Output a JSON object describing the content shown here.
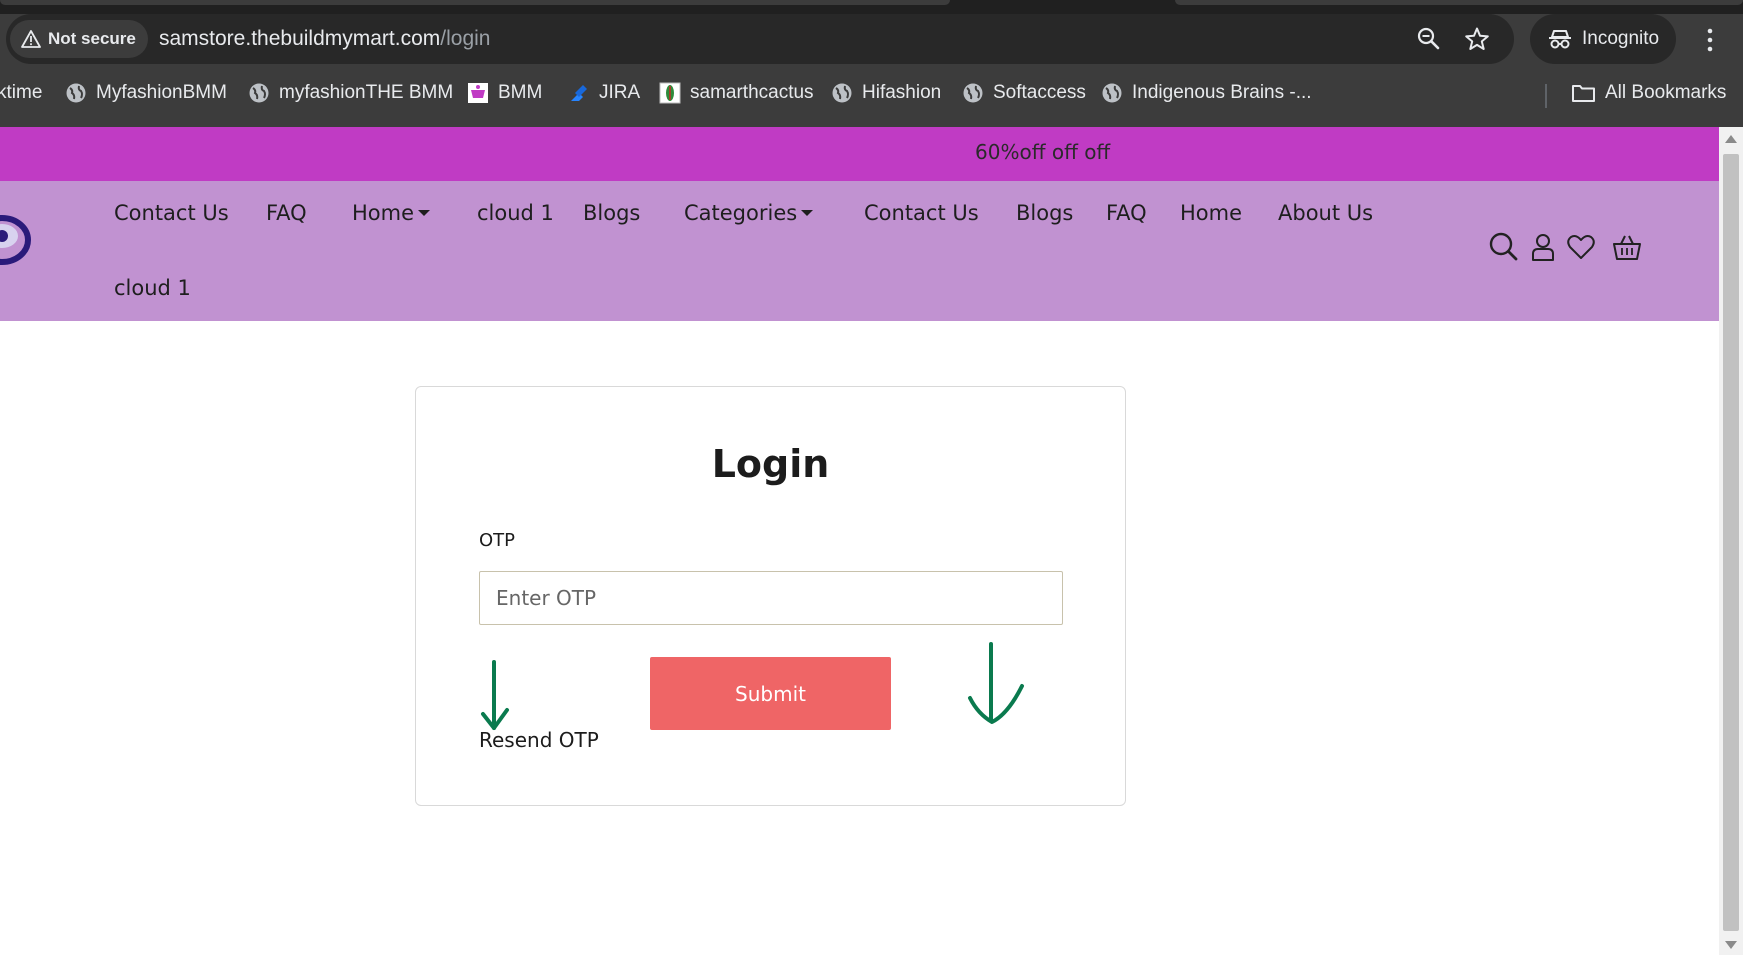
{
  "browser": {
    "security_label": "Not secure",
    "url_host": "samstore.thebuildmymart.com",
    "url_path": "/login",
    "profile_label": "Incognito"
  },
  "bookmarks": [
    {
      "label": "ktime",
      "icon": "none"
    },
    {
      "label": "MyfashionBMM",
      "icon": "globe-icon"
    },
    {
      "label": "myfashionTHE BMM",
      "icon": "globe-icon"
    },
    {
      "label": "BMM",
      "icon": "bmm-favicon"
    },
    {
      "label": "JIRA",
      "icon": "jira-icon"
    },
    {
      "label": "samarthcactus",
      "icon": "cactus-favicon"
    },
    {
      "label": "Hifashion",
      "icon": "globe-icon"
    },
    {
      "label": "Softaccess",
      "icon": "globe-icon"
    },
    {
      "label": "Indigenous Brains -...",
      "icon": "globe-icon"
    }
  ],
  "all_bookmarks_label": "All Bookmarks",
  "promo": {
    "text": "60%off off off"
  },
  "nav": {
    "items": [
      "Contact Us",
      "FAQ",
      "Home",
      "cloud 1",
      "Blogs",
      "Categories",
      "Contact Us",
      "Blogs",
      "FAQ",
      "Home",
      "About Us",
      "cloud 1"
    ]
  },
  "login": {
    "title": "Login",
    "otp_label": "OTP",
    "otp_placeholder": "Enter OTP",
    "otp_value": "",
    "submit_label": "Submit",
    "resend_label": "Resend OTP"
  },
  "colors": {
    "promo_bg": "#c03bc4",
    "nav_bg": "#c192d1",
    "submit_bg": "#ef6566",
    "annotation": "#0a7a4e"
  }
}
